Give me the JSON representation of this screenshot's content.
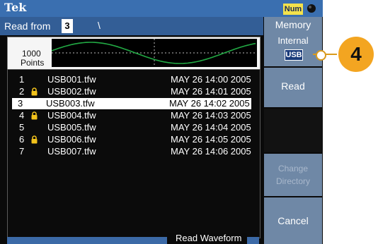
{
  "topbar": {
    "brand": "Tek",
    "num_badge": "Num",
    "lock_icon": "lock-icon"
  },
  "header": {
    "read_from_label": "Read from",
    "read_from_value": "3",
    "path": "\\"
  },
  "preview": {
    "points_value": "1000",
    "points_label": "Points"
  },
  "files": [
    {
      "index": "1",
      "locked": false,
      "name": "USB001.tfw",
      "date": "MAY 26 14:00 2005",
      "selected": false
    },
    {
      "index": "2",
      "locked": true,
      "name": "USB002.tfw",
      "date": "MAY 26 14:01 2005",
      "selected": false
    },
    {
      "index": "3",
      "locked": false,
      "name": "USB003.tfw",
      "date": "MAY 26 14:02 2005",
      "selected": true
    },
    {
      "index": "4",
      "locked": true,
      "name": "USB004.tfw",
      "date": "MAY 26 14:03 2005",
      "selected": false
    },
    {
      "index": "5",
      "locked": false,
      "name": "USB005.tfw",
      "date": "MAY 26 14:04 2005",
      "selected": false
    },
    {
      "index": "6",
      "locked": true,
      "name": "USB006.tfw",
      "date": "MAY 26 14:05 2005",
      "selected": false
    },
    {
      "index": "7",
      "locked": false,
      "name": "USB007.tfw",
      "date": "MAY 26 14:06 2005",
      "selected": false
    }
  ],
  "tabs": {
    "read_waveform": "Read Waveform"
  },
  "sidebar": {
    "memory_title": "Memory",
    "memory_internal": "Internal",
    "memory_usb": "USB",
    "read": "Read",
    "change_line1": "Change",
    "change_line2": "Directory",
    "cancel": "Cancel"
  },
  "callout": {
    "number": "4"
  },
  "colors": {
    "accent": "#3a6fb0",
    "callout": "#f3a521",
    "waveform": "#22aa44"
  }
}
